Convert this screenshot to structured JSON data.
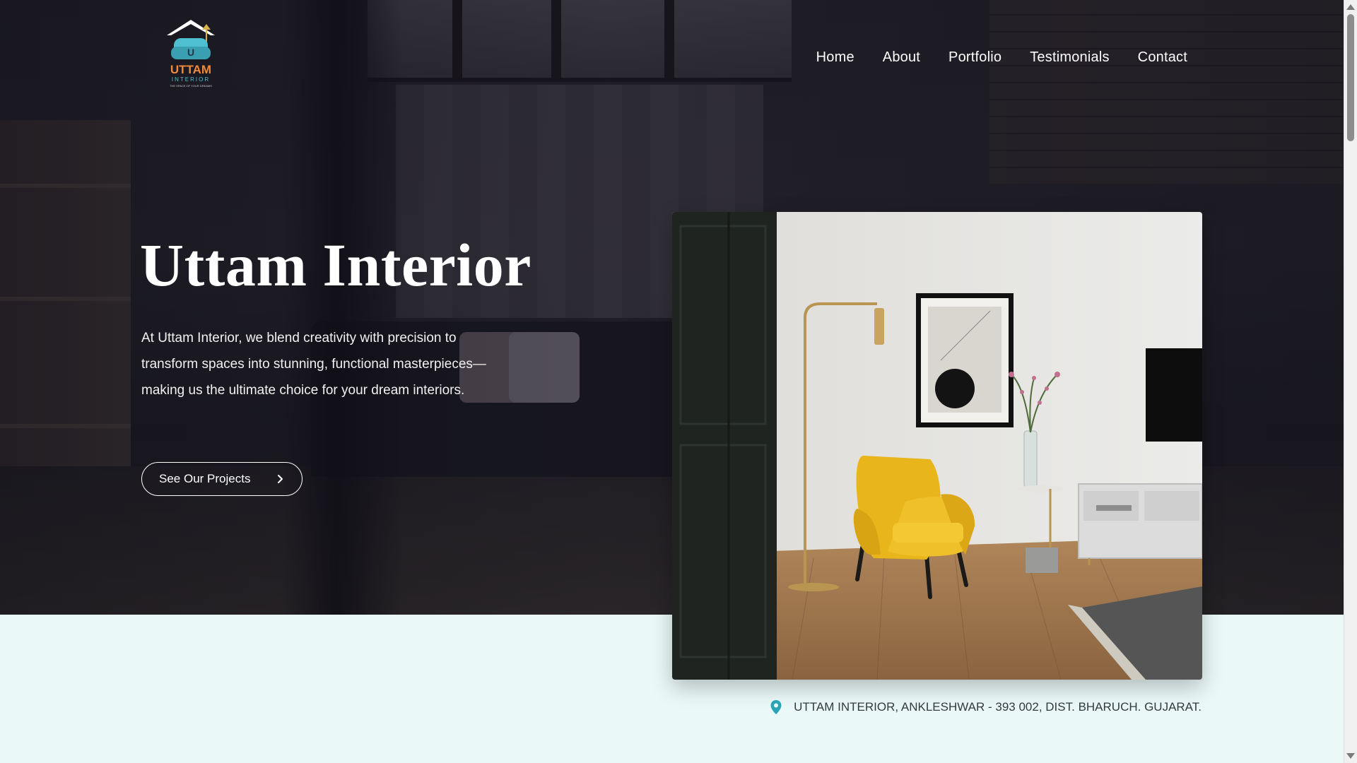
{
  "brand": {
    "logo_top": "UTTAM",
    "logo_bottom": "INTERIOR",
    "logo_tagline": "THE SPACE OF YOUR DREAMS",
    "logo_letter": "U"
  },
  "nav": {
    "items": [
      {
        "label": "Home"
      },
      {
        "label": "About"
      },
      {
        "label": "Portfolio"
      },
      {
        "label": "Testimonials"
      },
      {
        "label": "Contact"
      }
    ]
  },
  "hero": {
    "title": "Uttam Interior",
    "description": "At Uttam Interior, we blend creativity with precision to transform spaces into stunning, functional masterpieces—making us the ultimate choice for your dream interiors.",
    "cta_label": "See Our Projects"
  },
  "address": {
    "text": "UTTAM INTERIOR, ANKLESHWAR - 393 002, DIST. BHARUCH. GUJARAT."
  },
  "colors": {
    "accent": "#2aa3b6",
    "section_bg": "#eaf8f8",
    "chair_yellow": "#e8b51a"
  },
  "icons": {
    "cta": "chevron-right-icon",
    "address": "map-pin-icon"
  }
}
